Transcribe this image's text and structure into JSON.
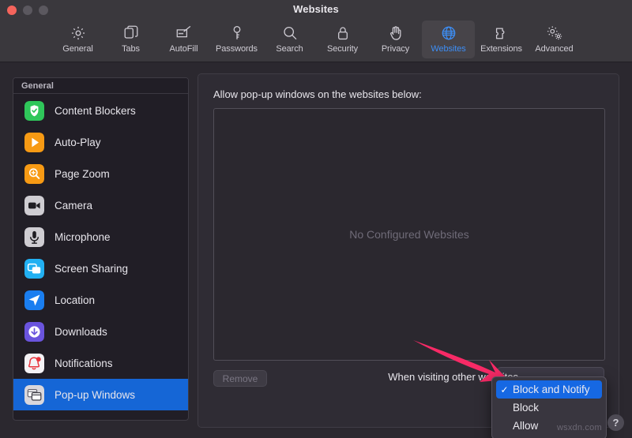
{
  "window": {
    "title": "Websites",
    "controls": [
      "close",
      "minimize",
      "zoom"
    ]
  },
  "toolbar": {
    "items": [
      {
        "label": "General",
        "icon": "gear-icon",
        "selected": false
      },
      {
        "label": "Tabs",
        "icon": "tabs-icon",
        "selected": false
      },
      {
        "label": "AutoFill",
        "icon": "autofill-icon",
        "selected": false
      },
      {
        "label": "Passwords",
        "icon": "key-icon",
        "selected": false
      },
      {
        "label": "Search",
        "icon": "magnifier-icon",
        "selected": false
      },
      {
        "label": "Security",
        "icon": "lock-icon",
        "selected": false
      },
      {
        "label": "Privacy",
        "icon": "hand-icon",
        "selected": false
      },
      {
        "label": "Websites",
        "icon": "globe-icon",
        "selected": true
      },
      {
        "label": "Extensions",
        "icon": "puzzle-icon",
        "selected": false
      },
      {
        "label": "Advanced",
        "icon": "gears-icon",
        "selected": false
      }
    ]
  },
  "sidebar": {
    "header": "General",
    "items": [
      {
        "label": "Content Blockers",
        "icon": "shield-check-icon",
        "selected": false
      },
      {
        "label": "Auto-Play",
        "icon": "play-icon",
        "selected": false
      },
      {
        "label": "Page Zoom",
        "icon": "zoom-in-icon",
        "selected": false
      },
      {
        "label": "Camera",
        "icon": "camera-icon",
        "selected": false
      },
      {
        "label": "Microphone",
        "icon": "microphone-icon",
        "selected": false
      },
      {
        "label": "Screen Sharing",
        "icon": "screen-share-icon",
        "selected": false
      },
      {
        "label": "Location",
        "icon": "location-icon",
        "selected": false
      },
      {
        "label": "Downloads",
        "icon": "download-icon",
        "selected": false
      },
      {
        "label": "Notifications",
        "icon": "bell-icon",
        "selected": false
      },
      {
        "label": "Pop-up Windows",
        "icon": "popup-windows-icon",
        "selected": true
      }
    ]
  },
  "main": {
    "heading": "Allow pop-up windows on the websites below:",
    "empty_state": "No Configured Websites",
    "remove_label": "Remove",
    "remove_disabled": true,
    "other_websites_label": "When visiting other websites"
  },
  "dropdown": {
    "selected": "Block and Notify",
    "check_glyph": "✓",
    "options": [
      {
        "label": "Block and Notify",
        "checked": true
      },
      {
        "label": "Block",
        "checked": false
      },
      {
        "label": "Allow",
        "checked": false
      }
    ]
  },
  "help": {
    "label": "?"
  },
  "watermark": {
    "text": "wsxdn.com"
  },
  "colors": {
    "accent_blue": "#1566d6",
    "menu_highlight": "#1668e3",
    "websites_tab_blue": "#3d8ef5",
    "annotation_pink": "#f72a66",
    "window_chrome": "#3a383d",
    "content_bg": "#2f2c34",
    "sidebar_bg": "#211e26"
  }
}
